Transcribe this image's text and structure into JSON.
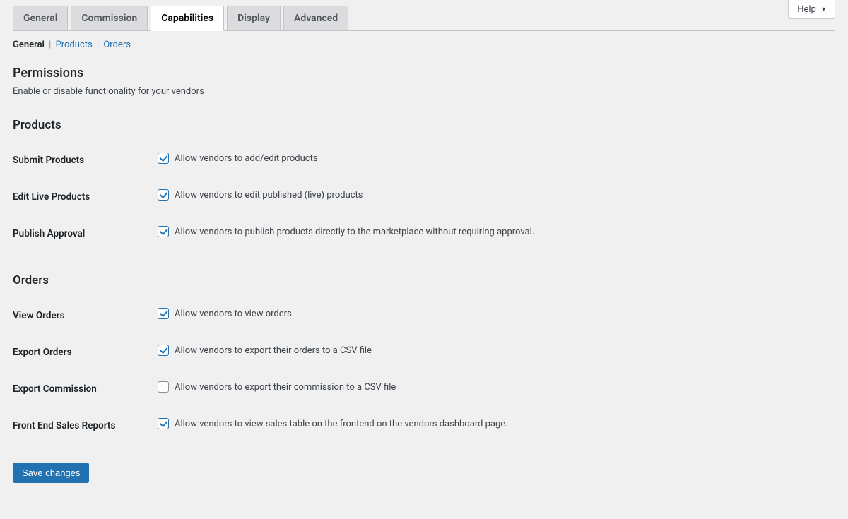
{
  "help": {
    "label": "Help"
  },
  "nav_tabs": [
    {
      "label": "General",
      "active": false
    },
    {
      "label": "Commission",
      "active": false
    },
    {
      "label": "Capabilities",
      "active": true
    },
    {
      "label": "Display",
      "active": false
    },
    {
      "label": "Advanced",
      "active": false
    }
  ],
  "sub_nav": [
    {
      "label": "General",
      "current": true
    },
    {
      "label": "Products",
      "current": false
    },
    {
      "label": "Orders",
      "current": false
    }
  ],
  "permissions": {
    "heading": "Permissions",
    "description": "Enable or disable functionality for your vendors"
  },
  "products_section": {
    "heading": "Products",
    "rows": [
      {
        "name": "submit-products",
        "label": "Submit Products",
        "checked": true,
        "text": "Allow vendors to add/edit products"
      },
      {
        "name": "edit-live-products",
        "label": "Edit Live Products",
        "checked": true,
        "text": "Allow vendors to edit published (live) products"
      },
      {
        "name": "publish-approval",
        "label": "Publish Approval",
        "checked": true,
        "text": "Allow vendors to publish products directly to the marketplace without requiring approval."
      }
    ]
  },
  "orders_section": {
    "heading": "Orders",
    "rows": [
      {
        "name": "view-orders",
        "label": "View Orders",
        "checked": true,
        "text": "Allow vendors to view orders"
      },
      {
        "name": "export-orders",
        "label": "Export Orders",
        "checked": true,
        "text": "Allow vendors to export their orders to a CSV file"
      },
      {
        "name": "export-commission",
        "label": "Export Commission",
        "checked": false,
        "text": "Allow vendors to export their commission to a CSV file"
      },
      {
        "name": "front-end-sales-reports",
        "label": "Front End Sales Reports",
        "checked": true,
        "text": "Allow vendors to view sales table on the frontend on the vendors dashboard page."
      }
    ]
  },
  "save": {
    "label": "Save changes"
  }
}
